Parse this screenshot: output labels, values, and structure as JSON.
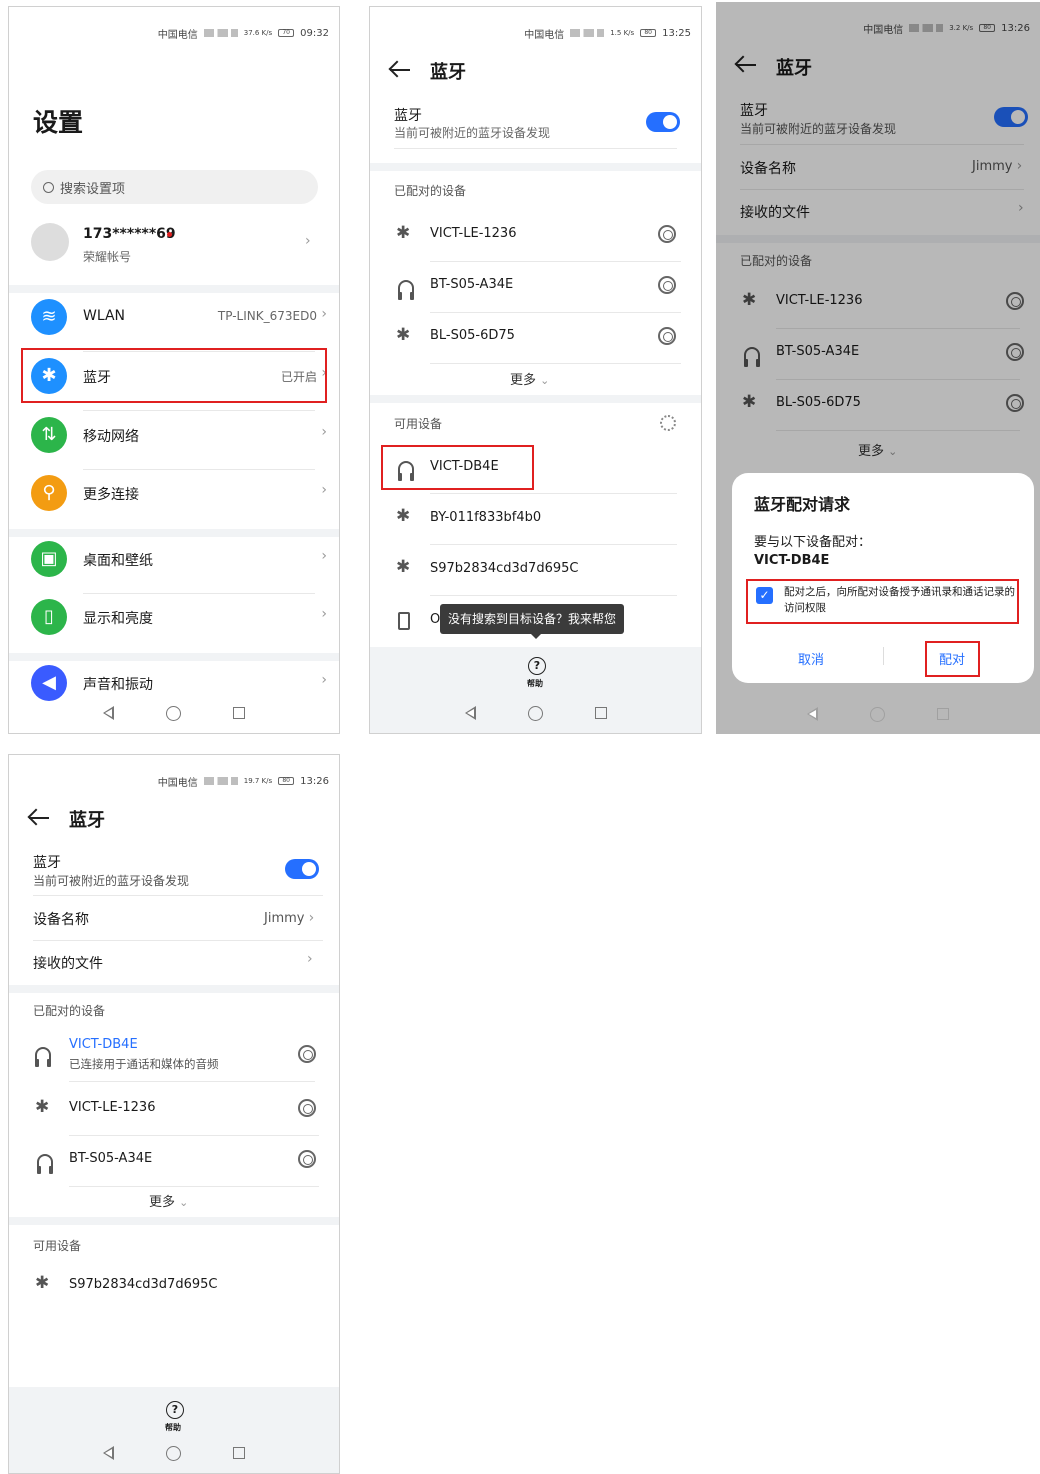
{
  "status_bars": {
    "p1": {
      "carrier": "中国电信",
      "speed": "37.6 K/s",
      "battery": "70",
      "time": "09:32"
    },
    "p2": {
      "carrier": "中国电信",
      "speed": "1.5 K/s",
      "battery": "80",
      "time": "13:25"
    },
    "p3": {
      "carrier": "中国电信",
      "speed": "3.2 K/s",
      "battery": "80",
      "time": "13:26"
    },
    "p4": {
      "carrier": "中国电信",
      "speed": "19.7 K/s",
      "battery": "80",
      "time": "13:26"
    }
  },
  "settings": {
    "title": "设置",
    "search_placeholder": "搜索设置项",
    "account": {
      "name": "173******69",
      "sub": "荣耀帐号"
    },
    "items": [
      {
        "label": "WLAN",
        "value": "TP-LINK_673ED0",
        "color": "#1e90ff",
        "icon": "wifi-icon"
      },
      {
        "label": "蓝牙",
        "value": "已开启",
        "color": "#1e90ff",
        "icon": "bluetooth-icon"
      },
      {
        "label": "移动网络",
        "value": "",
        "color": "#2cb54a",
        "icon": "mobile-data-icon"
      },
      {
        "label": "更多连接",
        "value": "",
        "color": "#f39c12",
        "icon": "link-icon"
      },
      {
        "label": "桌面和壁纸",
        "value": "",
        "color": "#2cb54a",
        "icon": "wallpaper-icon"
      },
      {
        "label": "显示和亮度",
        "value": "",
        "color": "#2cb54a",
        "icon": "display-icon"
      },
      {
        "label": "声音和振动",
        "value": "",
        "color": "#3a5bff",
        "icon": "sound-icon"
      }
    ]
  },
  "bt": {
    "title": "蓝牙",
    "switch_label": "蓝牙",
    "switch_sub": "当前可被附近的蓝牙设备发现",
    "device_name_label": "设备名称",
    "device_name_value": "Jimmy",
    "received_files": "接收的文件",
    "paired_header": "已配对的设备",
    "available_header": "可用设备",
    "more": "更多",
    "help": "帮助",
    "help_tip": "没有搜索到目标设备？我来帮您",
    "paired": [
      "VICT-LE-1236",
      "BT-S05-A34E",
      "BL-S05-6D75"
    ],
    "available": [
      "VICT-DB4E",
      "BY-011f833bf4b0",
      "S97b2834cd3d7d695C",
      "O"
    ],
    "connected_device": "VICT-DB4E",
    "connected_sub": "已连接用于通话和媒体的音频"
  },
  "dialog": {
    "title": "蓝牙配对请求",
    "line1": "要与以下设备配对：",
    "device": "VICT-DB4E",
    "checkbox_text": "配对之后，向所配对设备授予通讯录和通话记录的访问权限",
    "cancel": "取消",
    "pair": "配对"
  }
}
